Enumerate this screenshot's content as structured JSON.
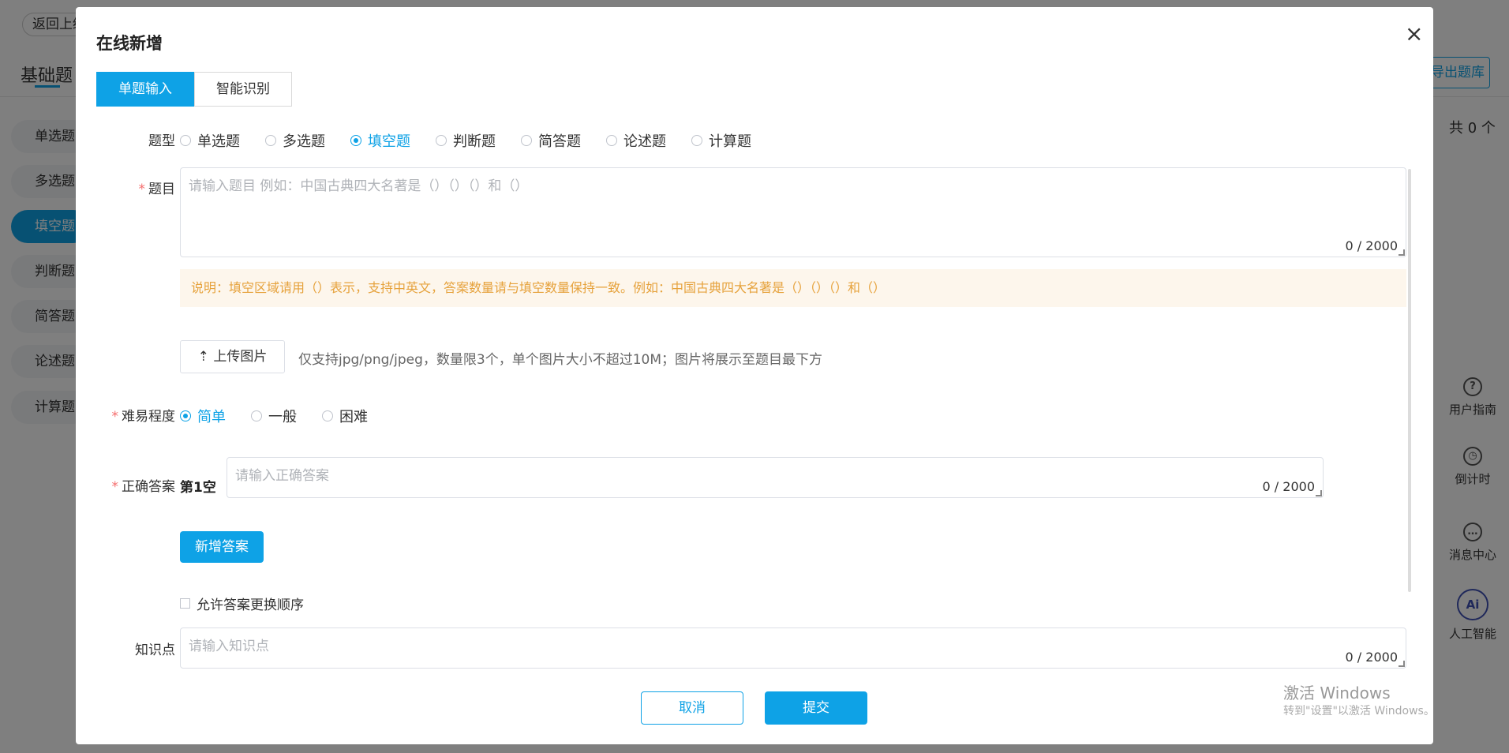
{
  "background": {
    "back_button": "返回上级",
    "page_title": "基础题",
    "export_button": "导出题库",
    "total_count": "共 0 个",
    "menu": [
      "单选题",
      "多选题",
      "填空题",
      "判断题",
      "简答题",
      "论述题",
      "计算题"
    ],
    "active_menu_index": 2,
    "side_tools": [
      {
        "label": "用户指南",
        "icon": "help-icon"
      },
      {
        "label": "倒计时",
        "icon": "alarm-clock-icon"
      },
      {
        "label": "消息中心",
        "icon": "message-icon"
      },
      {
        "label": "人工智能",
        "icon": "ai-icon"
      }
    ]
  },
  "modal": {
    "title": "在线新增",
    "close_glyph": "×",
    "tabs": [
      {
        "label": "单题输入",
        "active": true
      },
      {
        "label": "智能识别",
        "active": false
      }
    ],
    "question_type": {
      "label": "题型",
      "options": [
        "单选题",
        "多选题",
        "填空题",
        "判断题",
        "简答题",
        "论述题",
        "计算题"
      ],
      "selected": "填空题"
    },
    "question": {
      "label": "题目",
      "placeholder": "请输入题目 例如：中国古典四大名著是（）（）（）和（）",
      "count": "0 / 2000"
    },
    "notice": "说明：填空区域请用（）表示，支持中英文，答案数量请与填空数量保持一致。例如：中国古典四大名著是（）（）（）和（）",
    "upload": {
      "button": "上传图片",
      "tip": "仅支持jpg/png/jpeg，数量限3个，单个图片大小不超过10M；图片将展示至题目最下方"
    },
    "difficulty": {
      "label": "难易程度",
      "options": [
        "简单",
        "一般",
        "困难"
      ],
      "selected": "简单"
    },
    "answer": {
      "label": "正确答案",
      "blank_label": "第1空",
      "placeholder": "请输入正确答案",
      "count": "0 / 2000",
      "add_button": "新增答案",
      "allow_reorder": "允许答案更换顺序"
    },
    "knowledge": {
      "label": "知识点",
      "placeholder": "请输入知识点",
      "count": "0 / 2000"
    },
    "footer": {
      "cancel": "取消",
      "submit": "提交"
    }
  },
  "watermark": {
    "line1": "激活 Windows",
    "line2": "转到\"设置\"以激活 Windows。"
  },
  "colors": {
    "accent": "#0ea2e6",
    "required": "#f56c6c",
    "notice_text": "#e6a23c",
    "notice_bg": "#fdf6ec"
  }
}
